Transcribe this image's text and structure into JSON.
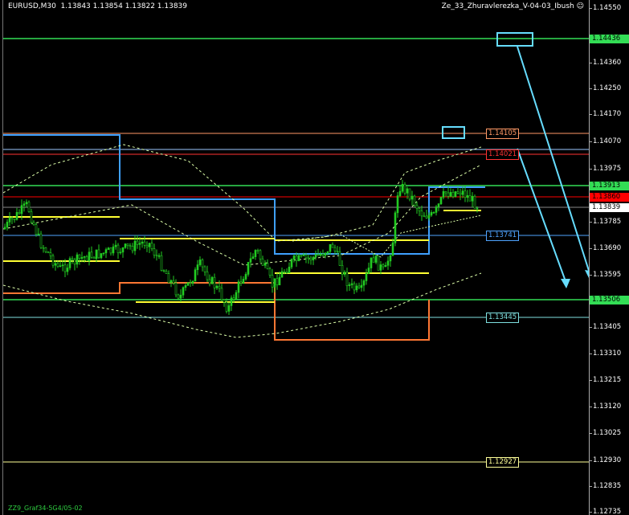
{
  "window": {
    "symbol_info": "EURUSD,M30  1.13843 1.13854 1.13822 1.13839",
    "indicator_name": "Ze_33_Zhuravlerezka_V-04-03_Ibush",
    "bottom_label": "ZZ9_Graf34-5G4/05-02",
    "smiley_icon": "smiley-face-icon"
  },
  "price_axis": {
    "ticks": [
      "1.14550",
      "1.14436",
      "1.14360",
      "1.14250",
      "1.14170",
      "1.14070",
      "1.13975",
      "1.13913",
      "1.13860",
      "1.13839",
      "1.13785",
      "1.13690",
      "1.13595",
      "1.13506",
      "1.13405",
      "1.13310",
      "1.13215",
      "1.13120",
      "1.13025",
      "1.12930",
      "1.12835",
      "1.12735"
    ],
    "current_price": "1.13839",
    "current_price_color": "#ffffff",
    "red_tag": "1.13860",
    "red_tag_color": "#ff0000",
    "green_tag_upper": "1.14436",
    "green_tag_lower": "1.13506",
    "green_tag_mid": "1.13913",
    "green_color": "#33dd55"
  },
  "levels": [
    {
      "name": "level-114105",
      "label": "1.14105",
      "color": "#ff9966"
    },
    {
      "name": "level-114021",
      "label": "1.14021",
      "color": "#ff3333"
    },
    {
      "name": "level-113741",
      "label": "1.13741",
      "color": "#4fa3ff"
    },
    {
      "name": "level-113445",
      "label": "1.13445",
      "color": "#7fe0e0"
    },
    {
      "name": "level-112927",
      "label": "1.12927",
      "color": "#ffff99"
    }
  ],
  "colors": {
    "candle": "#22cc22",
    "blue_line": "#3fa0ff",
    "orange_line": "#ff7733",
    "yellow_line": "#ffff33",
    "arrow": "#66ddff",
    "band": "#ddffaa"
  }
}
